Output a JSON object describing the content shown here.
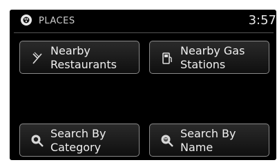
{
  "header": {
    "title": "PLACES",
    "time": "3:57"
  },
  "buttons": [
    {
      "label": "Nearby\nRestaurants",
      "icon": "utensils-icon"
    },
    {
      "label": "Nearby Gas\nStations",
      "icon": "gas-pump-icon"
    },
    {
      "label": "Search By\nCategory",
      "icon": "search-category-icon"
    },
    {
      "label": "Search By\nName",
      "icon": "search-name-icon"
    }
  ],
  "colors": {
    "background": "#000000",
    "text": "#f0f0f0",
    "button_border": "#8a8a8a"
  }
}
